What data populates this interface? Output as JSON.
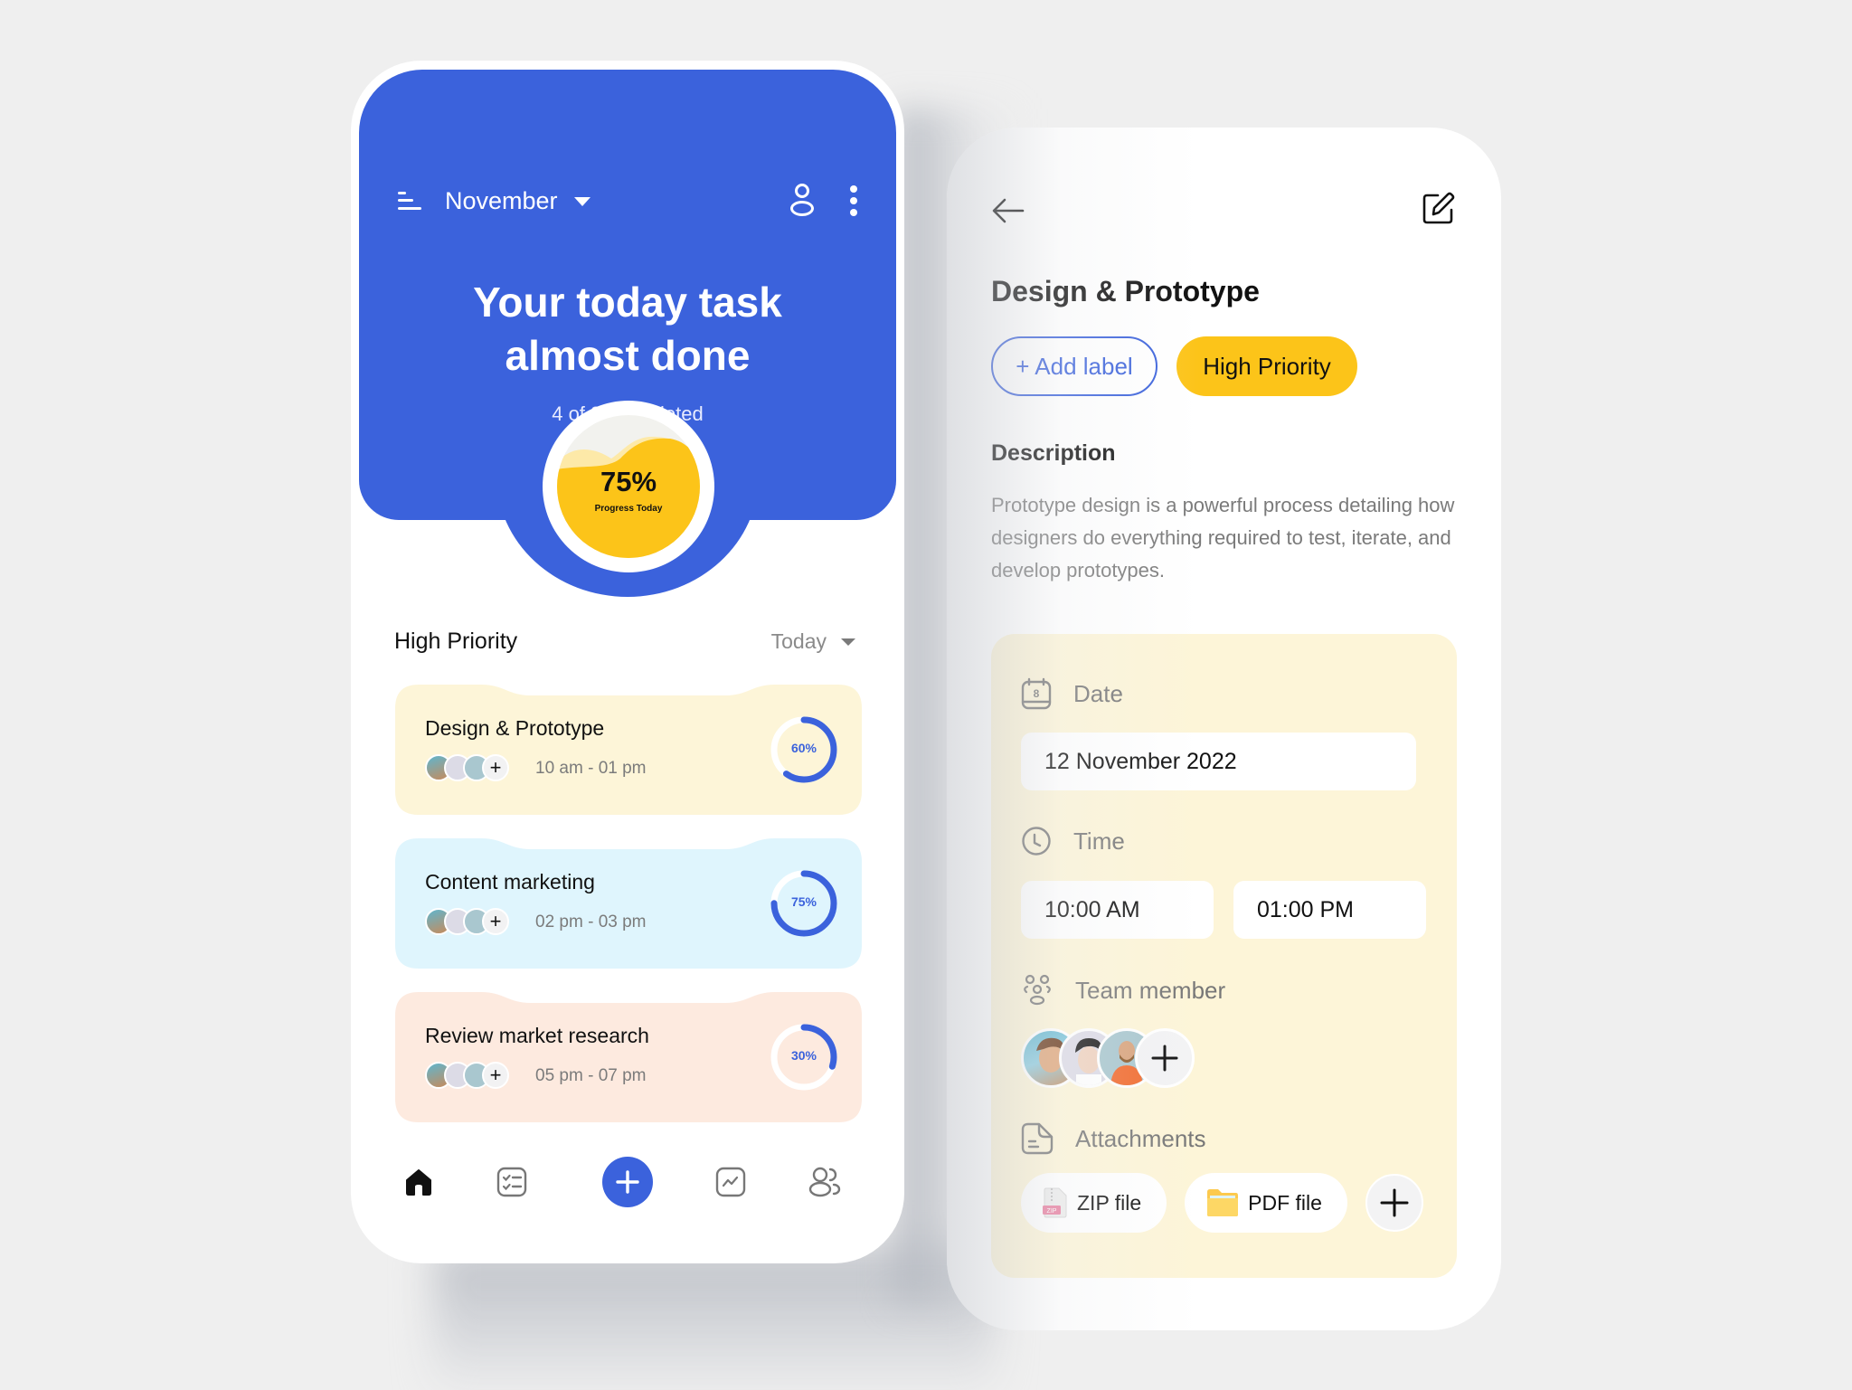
{
  "colors": {
    "primary": "#3b62dc",
    "accent_yellow": "#fcc419",
    "card_yellow": "#fdf5d8",
    "card_blue": "#dff5fd",
    "card_peach": "#fdeadf",
    "background": "#efefef"
  },
  "home": {
    "header": {
      "menu_icon": "menu-icon",
      "month": "November",
      "profile_icon": "user-icon",
      "more_icon": "more-vertical-icon"
    },
    "hero": {
      "title_line1": "Your today task",
      "title_line2": "almost done",
      "completed_text": "4 of 8 Completed",
      "progress_percent": 75,
      "progress_text": "75%",
      "progress_label": "Progress Today"
    },
    "section": {
      "title": "High Priority",
      "filter": "Today"
    },
    "tasks": [
      {
        "title": "Design & Prototype",
        "time": "10 am - 01 pm",
        "progress": 60,
        "progress_text": "60%",
        "color": "#fdf5d8"
      },
      {
        "title": "Content marketing",
        "time": "02 pm - 03 pm",
        "progress": 75,
        "progress_text": "75%",
        "color": "#dff5fd"
      },
      {
        "title": "Review market research",
        "time": "05 pm - 07 pm",
        "progress": 30,
        "progress_text": "30%",
        "color": "#fdeadf"
      }
    ],
    "task_add_member": "+",
    "bottom_nav": [
      {
        "icon": "home-icon",
        "active": true
      },
      {
        "icon": "checklist-icon",
        "active": false
      },
      {
        "icon": "add-icon",
        "active": false
      },
      {
        "icon": "chart-icon",
        "active": false
      },
      {
        "icon": "users-icon",
        "active": false
      }
    ]
  },
  "detail": {
    "back_icon": "arrow-left-icon",
    "edit_icon": "edit-icon",
    "title": "Design & Prototype",
    "add_label": "+ Add label",
    "priority_label": "High Priority",
    "description_title": "Description",
    "description": "Prototype design is a powerful process detailing how designers do everything required to test, iterate, and develop prototypes.",
    "date_label": "Date",
    "date_icon_day": "8",
    "date_value": "12 November 2022",
    "time_label": "Time",
    "time_start": "10:00 AM",
    "time_end": "01:00 PM",
    "team_label": "Team member",
    "attachments_label": "Attachments",
    "attachments": [
      {
        "name": "ZIP file",
        "icon": "zip-file-icon",
        "badge": "ZIP"
      },
      {
        "name": "PDF file",
        "icon": "folder-icon"
      }
    ]
  }
}
